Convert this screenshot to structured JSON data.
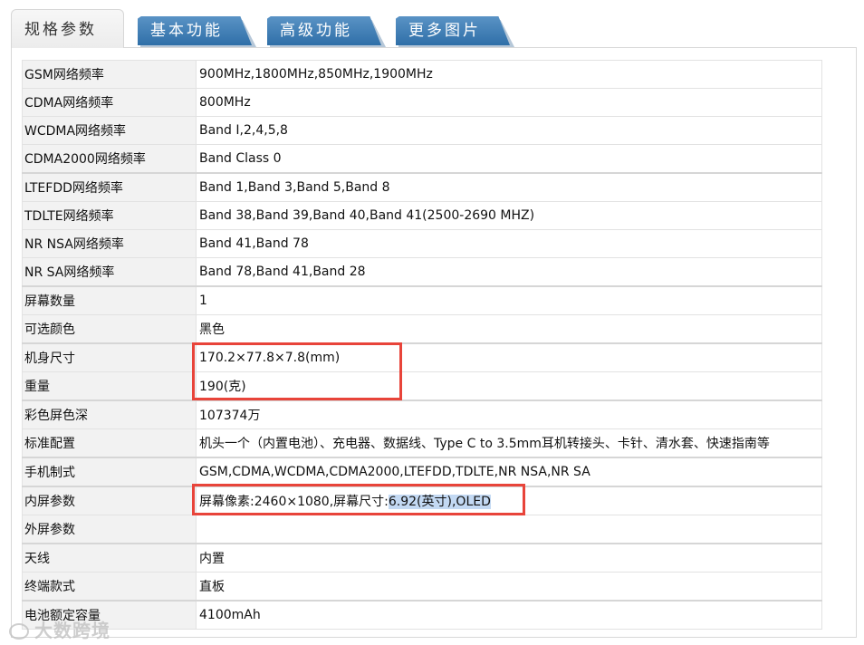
{
  "tabs": [
    {
      "label": "规格参数",
      "active": true
    },
    {
      "label": "基本功能",
      "active": false
    },
    {
      "label": "高级功能",
      "active": false
    },
    {
      "label": "更多图片",
      "active": false
    }
  ],
  "specs": [
    {
      "key": "GSM网络频率",
      "value": "900MHz,1800MHz,850MHz,1900MHz"
    },
    {
      "key": "CDMA网络频率",
      "value": "800MHz"
    },
    {
      "key": "WCDMA网络频率",
      "value": "Band Ⅰ,2,4,5,8"
    },
    {
      "key": "CDMA2000网络频率",
      "value": "Band Class 0"
    },
    {
      "key": "LTEFDD网络频率",
      "value": "Band 1,Band 3,Band 5,Band 8"
    },
    {
      "key": "TDLTE网络频率",
      "value": "Band 38,Band 39,Band 40,Band 41(2500-2690 MHZ)"
    },
    {
      "key": "NR NSA网络频率",
      "value": "Band 41,Band 78"
    },
    {
      "key": "NR SA网络频率",
      "value": "Band 78,Band 41,Band 28"
    },
    {
      "key": "屏幕数量",
      "value": "1"
    },
    {
      "key": "可选颜色",
      "value": "黑色"
    },
    {
      "key": "机身尺寸",
      "value": "170.2×77.8×7.8(mm)"
    },
    {
      "key": "重量",
      "value": "190(克)"
    },
    {
      "key": "彩色屏色深",
      "value": "107374万"
    },
    {
      "key": "标准配置",
      "value": "机头一个（内置电池）、充电器、数据线、Type C to 3.5mm耳机转接头、卡针、清水套、快速指南等"
    },
    {
      "key": "手机制式",
      "value": "GSM,CDMA,WCDMA,CDMA2000,LTEFDD,TDLTE,NR NSA,NR SA"
    },
    {
      "key": "内屏参数",
      "value_plain": "屏幕像素:2460×1080,屏幕尺寸:",
      "value_highlight": "6.92(英寸),OLED"
    },
    {
      "key": "外屏参数",
      "value": ""
    },
    {
      "key": "天线",
      "value": "内置"
    },
    {
      "key": "终端款式",
      "value": "直板"
    },
    {
      "key": "电池额定容量",
      "value": "4100mAh"
    }
  ],
  "watermark": "大数跨境",
  "colors": {
    "tab_blue": "#3a7bb5",
    "key_bg": "#f2f2f2",
    "annotation_red": "#e8443a",
    "selection_highlight": "#c3d9f3"
  }
}
